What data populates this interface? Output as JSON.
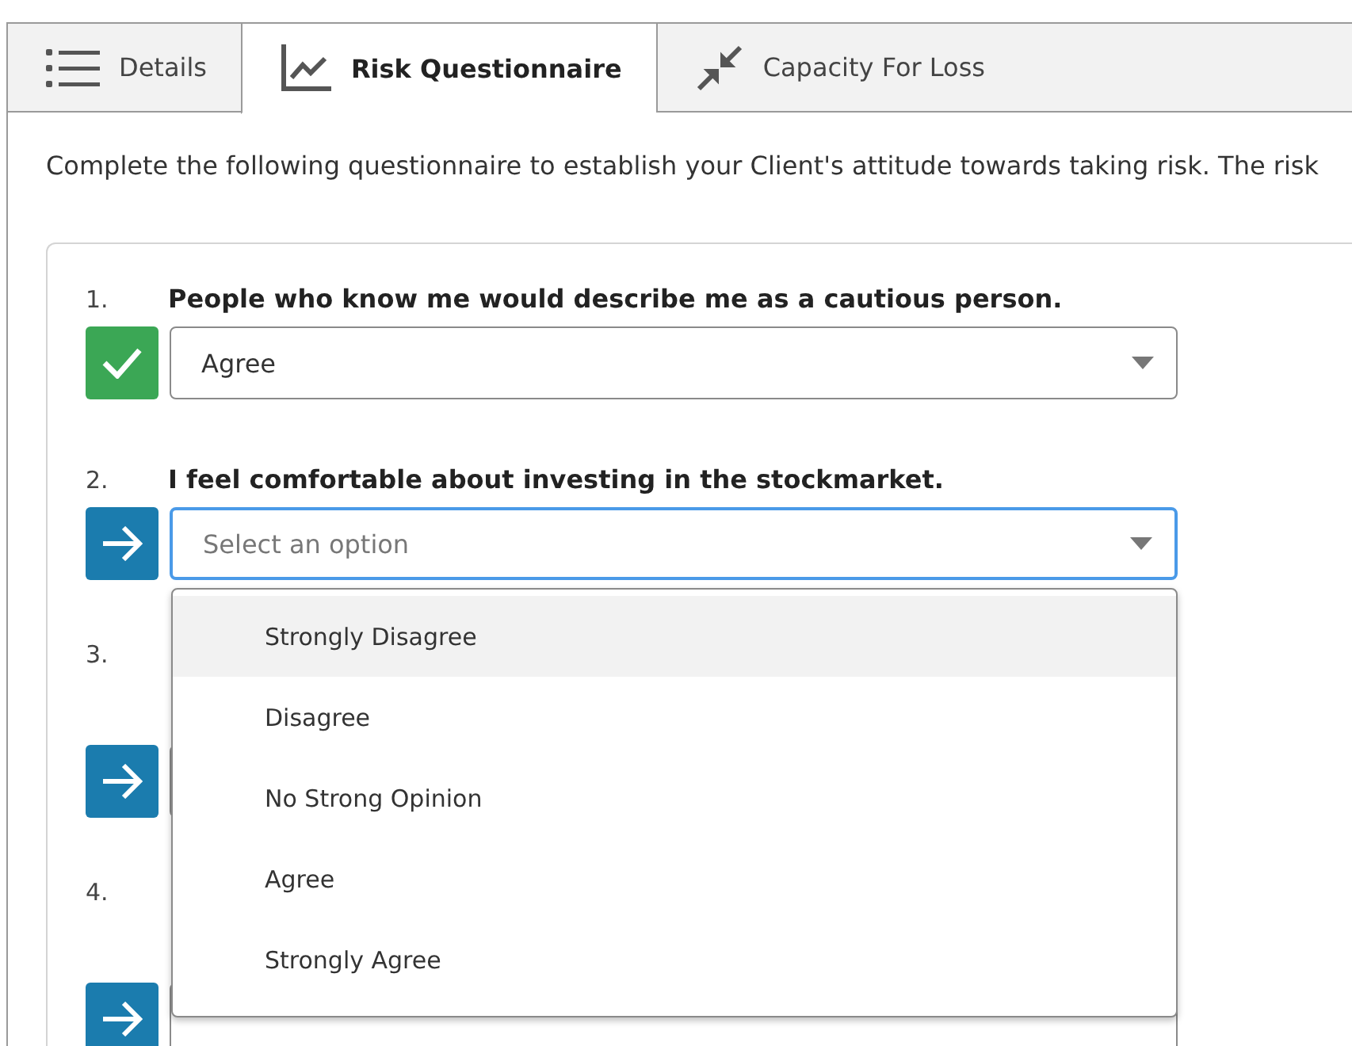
{
  "tabs": [
    {
      "label": "Details",
      "selected": false
    },
    {
      "label": "Risk Questionnaire",
      "selected": true
    },
    {
      "label": "Capacity For Loss",
      "selected": false
    }
  ],
  "intro": "Complete the following questionnaire to establish your Client's attitude towards taking risk. The risk",
  "questions": [
    {
      "number": "1.",
      "text": "People who know me would describe me as a cautious person.",
      "answered": true,
      "value": "Agree",
      "focused": false
    },
    {
      "number": "2.",
      "text": "I feel comfortable about investing in the stockmarket.",
      "answered": false,
      "placeholder": "Select an option",
      "focused": true,
      "dropdown": {
        "options": [
          {
            "label": "Strongly Disagree",
            "selected": true
          },
          {
            "label": "Disagree",
            "selected": false
          },
          {
            "label": "No Strong Opinion",
            "selected": false
          },
          {
            "label": "Agree",
            "selected": false
          },
          {
            "label": "Strongly Agree",
            "selected": false
          }
        ]
      }
    },
    {
      "number": "3.",
      "answered": false,
      "focused": false
    },
    {
      "number": "4.",
      "answered": false,
      "focused": false
    }
  ]
}
